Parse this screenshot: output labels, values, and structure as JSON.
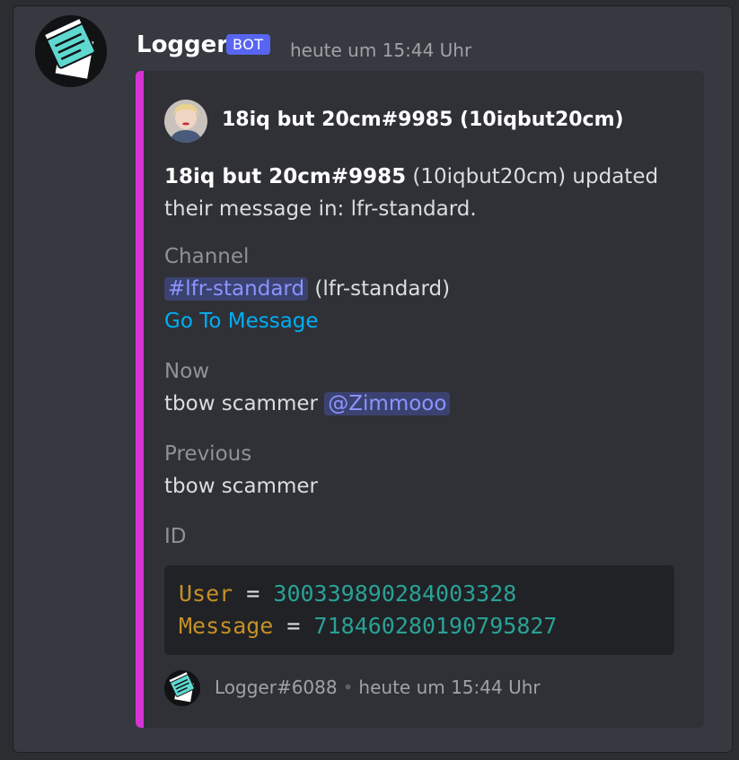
{
  "message": {
    "username": "Logger",
    "bot_tag": "BOT",
    "timestamp": "heute um 15:44 Uhr",
    "avatar_icon": "notepad-icon"
  },
  "embed": {
    "accent_color": "#d633d6",
    "author": {
      "name": "18iq but 20cm#9985 (10iqbut20cm)"
    },
    "description": {
      "bold": "18iq but 20cm#9985",
      "rest": " (10iqbut20cm) updated their message in: lfr-standard."
    },
    "fields": {
      "channel": {
        "name": "Channel",
        "mention": "#lfr-standard",
        "suffix": " (lfr-standard)",
        "link": "Go To Message"
      },
      "now": {
        "name": "Now",
        "text": "tbow scammer ",
        "mention": "@Zimmooo"
      },
      "previous": {
        "name": "Previous",
        "text": "tbow scammer"
      },
      "id": {
        "name": "ID",
        "user_key": "User",
        "user_value": "300339890284003328",
        "message_key": "Message",
        "message_value": "718460280190795827",
        "equals": "="
      }
    },
    "footer": {
      "name": "Logger#6088",
      "separator": "•",
      "timestamp": "heute um 15:44 Uhr"
    }
  }
}
